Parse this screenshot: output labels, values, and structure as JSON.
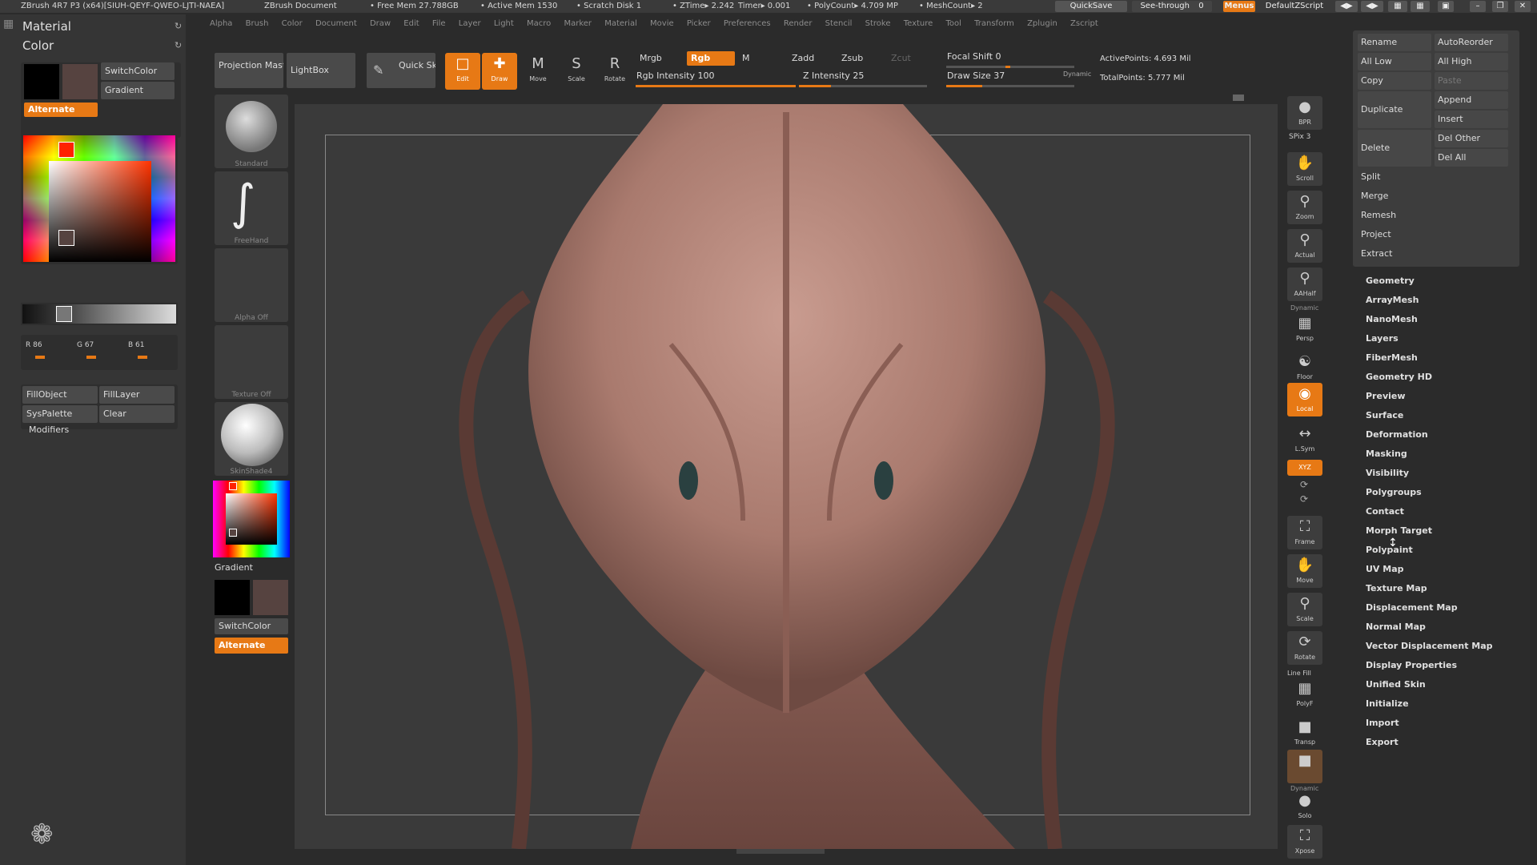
{
  "titlebar": {
    "app": "ZBrush 4R7 P3 (x64)[SIUH-QEYF-QWEO-LJTI-NAEA]",
    "document": "ZBrush Document",
    "free_mem": "• Free Mem 27.788GB",
    "active_mem": "• Active Mem 1530",
    "scratch_disk": "• Scratch Disk 1",
    "ztime": "• ZTime▸ 2.242",
    "timer": "Timer▸ 0.001",
    "polycount": "• PolyCount▸ 4.709 MP",
    "meshcount": "• MeshCount▸ 2",
    "quicksave": "QuickSave",
    "seethrough_label": "See-through",
    "seethrough_value": "0",
    "menus": "Menus",
    "script": "DefaultZScript"
  },
  "menubar": [
    "Alpha",
    "Brush",
    "Color",
    "Document",
    "Draw",
    "Edit",
    "File",
    "Layer",
    "Light",
    "Macro",
    "Marker",
    "Material",
    "Movie",
    "Picker",
    "Preferences",
    "Render",
    "Stencil",
    "Stroke",
    "Texture",
    "Tool",
    "Transform",
    "Zplugin",
    "Zscript"
  ],
  "left_panel": {
    "material_label": "Material",
    "color_label": "Color",
    "switch_color": "SwitchColor",
    "gradient": "Gradient",
    "alternate": "Alternate",
    "r_label": "R 86",
    "g_label": "G 67",
    "b_label": "B 61",
    "fill_object": "FillObject",
    "fill_layer": "FillLayer",
    "sys_palette": "SysPalette",
    "clear": "Clear",
    "modifiers": "Modifiers",
    "primary_color": "#000000",
    "secondary_color": "#564340"
  },
  "shelf": {
    "projection_master": "Projection Master",
    "lightbox": "LightBox",
    "quick_sketch": "Quick Sketch",
    "edit": "Edit",
    "draw": "Draw",
    "move": "Move",
    "scale": "Scale",
    "rotate": "Rotate",
    "mrgb": "Mrgb",
    "rgb": "Rgb",
    "m": "M",
    "zadd": "Zadd",
    "zsub": "Zsub",
    "zcut": "Zcut",
    "rgb_intensity": "Rgb Intensity 100",
    "z_intensity": "Z Intensity 25",
    "focal_shift": "Focal Shift 0",
    "draw_size": "Draw Size 37",
    "dynamic": "Dynamic",
    "active_points": "ActivePoints: 4.693 Mil",
    "total_points": "TotalPoints: 5.777 Mil"
  },
  "brush_column": {
    "standard": "Standard",
    "freehand": "FreeHand",
    "alpha_off": "Alpha Off",
    "texture_off": "Texture Off",
    "material": "SkinShade4",
    "gradient": "Gradient",
    "switch_color": "SwitchColor",
    "alternate": "Alternate"
  },
  "right_shelf": {
    "bpr": "BPR",
    "spix": "SPix 3",
    "scroll": "Scroll",
    "zoom": "Zoom",
    "actual": "Actual",
    "aahalf": "AAHalf",
    "dynamic": "Dynamic",
    "persp": "Persp",
    "floor": "Floor",
    "local": "Local",
    "lsym": "L.Sym",
    "xyz": "XYZ",
    "frame": "Frame",
    "move": "Move",
    "scale": "Scale",
    "rotate": "Rotate",
    "line_fill": "Line Fill",
    "polyf": "PolyF",
    "transp": "Transp",
    "dynamic2": "Dynamic",
    "solo": "Solo",
    "xpose": "Xpose"
  },
  "tool_panel": {
    "rename": "Rename",
    "autoreorder": "AutoReorder",
    "all_low": "All Low",
    "all_high": "All High",
    "copy": "Copy",
    "paste": "Paste",
    "append": "Append",
    "duplicate": "Duplicate",
    "insert": "Insert",
    "del_other": "Del Other",
    "delete": "Delete",
    "del_all": "Del All",
    "split": "Split",
    "merge": "Merge",
    "remesh": "Remesh",
    "project": "Project",
    "extract": "Extract"
  },
  "submenus": [
    "Geometry",
    "ArrayMesh",
    "NanoMesh",
    "Layers",
    "FiberMesh",
    "Geometry HD",
    "Preview",
    "Surface",
    "Deformation",
    "Masking",
    "Visibility",
    "Polygroups",
    "Contact",
    "Morph Target",
    "Polypaint",
    "UV Map",
    "Texture Map",
    "Displacement Map",
    "Normal Map",
    "Vector Displacement Map",
    "Display Properties",
    "Unified Skin",
    "Initialize",
    "Import",
    "Export"
  ],
  "colors": {
    "accent": "#e77915",
    "skin": "#b88c80"
  }
}
